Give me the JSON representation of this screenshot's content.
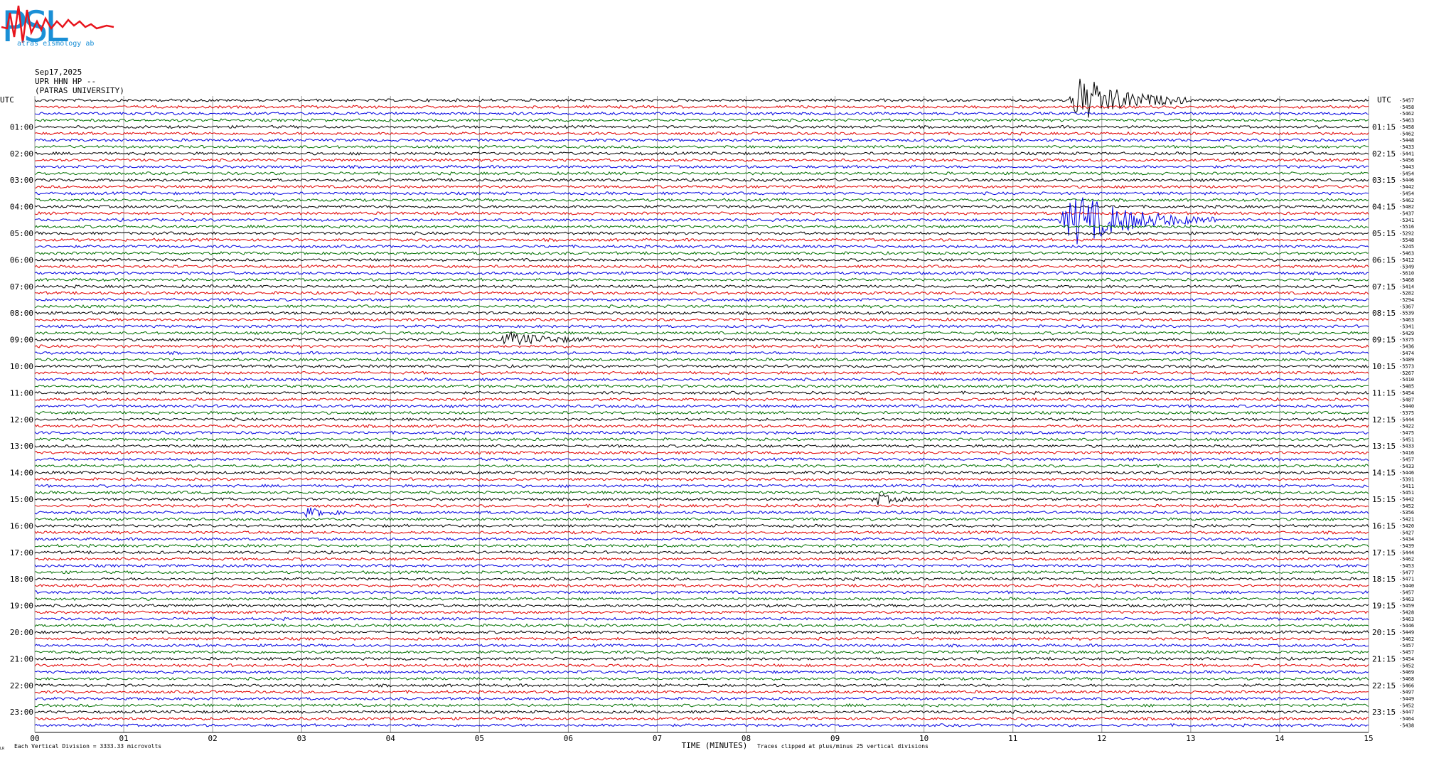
{
  "logo": {
    "text": "PSL",
    "subtitle": "atras  eismology  ab",
    "colors": {
      "letters": "#1a8fd6",
      "wave": "#e8141c"
    }
  },
  "header": {
    "date": "Sep17,2025",
    "station": "UPR HHN HP --",
    "institution": "(PATRAS UNIVERSITY)"
  },
  "chart_data": {
    "type": "line",
    "title": "",
    "left_axis_label": "UTC",
    "right_axis_label": "UTC",
    "left_hour_labels": [
      "01:00",
      "02:00",
      "03:00",
      "04:00",
      "05:00",
      "06:00",
      "07:00",
      "08:00",
      "09:00",
      "10:00",
      "11:00",
      "12:00",
      "13:00",
      "14:00",
      "15:00",
      "16:00",
      "17:00",
      "18:00",
      "19:00",
      "20:00",
      "21:00",
      "22:00",
      "23:00"
    ],
    "right_hour_labels": [
      "01:15",
      "02:15",
      "03:15",
      "04:15",
      "05:15",
      "06:15",
      "07:15",
      "08:15",
      "09:15",
      "10:15",
      "11:15",
      "12:15",
      "13:15",
      "14:15",
      "15:15",
      "16:15",
      "17:15",
      "18:15",
      "19:15",
      "20:15",
      "21:15",
      "22:15",
      "23:15"
    ],
    "x_ticks": [
      "00",
      "01",
      "02",
      "03",
      "04",
      "05",
      "06",
      "07",
      "08",
      "09",
      "10",
      "11",
      "12",
      "13",
      "14",
      "15"
    ],
    "xlim": [
      0,
      15
    ],
    "xlabel": "TIME (MINUTES)",
    "trace_colors": [
      "#000000",
      "#e00000",
      "#0000e0",
      "#007000"
    ],
    "trace_offsets": [
      "-5457",
      "-5458",
      "-5462",
      "-5463",
      "-5458",
      "-5462",
      "-5448",
      "-5433",
      "-5441",
      "-5456",
      "-5443",
      "-5454",
      "-5446",
      "-5442",
      "-5454",
      "-5462",
      "-5482",
      "-5437",
      "-5341",
      "-5516",
      "-5292",
      "-5548",
      "-5245",
      "-5463",
      "-5412",
      "-5349",
      "-5610",
      "-5468",
      "-5414",
      "-5282",
      "-5294",
      "-5367",
      "-5539",
      "-5463",
      "-5341",
      "-5429",
      "-5375",
      "-5436",
      "-5474",
      "-5489",
      "-5573",
      "-5267",
      "-5410",
      "-5485",
      "-5454",
      "-5487",
      "-5440",
      "-5375",
      "-5444",
      "-5422",
      "-5475",
      "-5451",
      "-5433",
      "-5416",
      "-5457",
      "-5433",
      "-5446",
      "-5391",
      "-5411",
      "-5451",
      "-5442",
      "-5452",
      "-5356",
      "-5421",
      "-5420",
      "-5427",
      "-5434",
      "-5439",
      "-5444",
      "-5462",
      "-5453",
      "-5477",
      "-5471",
      "-5440",
      "-5457",
      "-5463",
      "-5459",
      "-5428",
      "-5463",
      "-5446",
      "-5449",
      "-5462",
      "-5457",
      "-5457",
      "-5454",
      "-5452",
      "-5469",
      "-5468",
      "-5466",
      "-5497",
      "-5449",
      "-5452",
      "-5447",
      "-5464",
      "-5438"
    ],
    "grid": "vertical",
    "events": [
      {
        "trace": 0,
        "start_min": 11.6,
        "end_min": 13.0,
        "peak": 0.82
      },
      {
        "trace": 18,
        "start_min": 11.5,
        "end_min": 13.3,
        "peak": 0.9
      },
      {
        "trace": 36,
        "start_min": 5.2,
        "end_min": 6.5,
        "peak": 0.22
      },
      {
        "trace": 60,
        "start_min": 9.4,
        "end_min": 10.0,
        "peak": 0.18
      },
      {
        "trace": 62,
        "start_min": 3.0,
        "end_min": 3.6,
        "peak": 0.15
      }
    ]
  },
  "footer": {
    "division_note": "Each Vertical Division = 3333.33 microvolts",
    "clip_note": "Traces clipped at plus/minus 25 vertical divisions",
    "corner_mark": "LR"
  }
}
